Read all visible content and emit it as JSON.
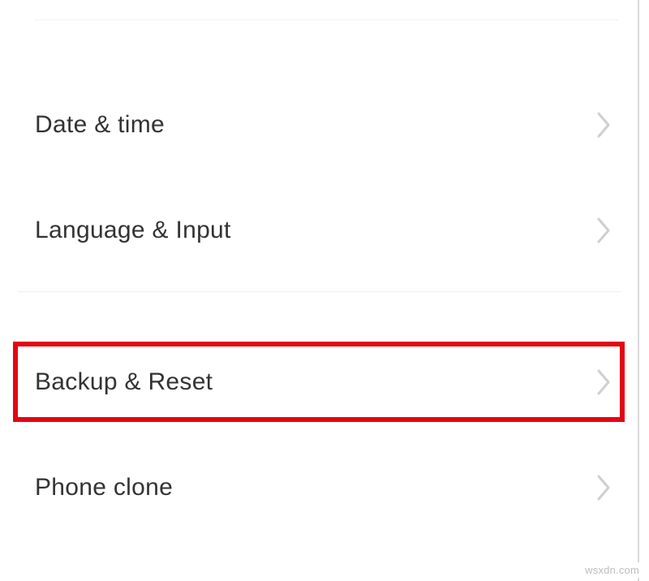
{
  "settings": {
    "group1": [
      {
        "label": "Date & time"
      },
      {
        "label": "Language & Input"
      }
    ],
    "group2": [
      {
        "label": "Backup & Reset",
        "highlighted": true
      },
      {
        "label": "Phone clone"
      }
    ]
  },
  "highlight_color": "#e30613",
  "watermark": "wsxdn.com"
}
